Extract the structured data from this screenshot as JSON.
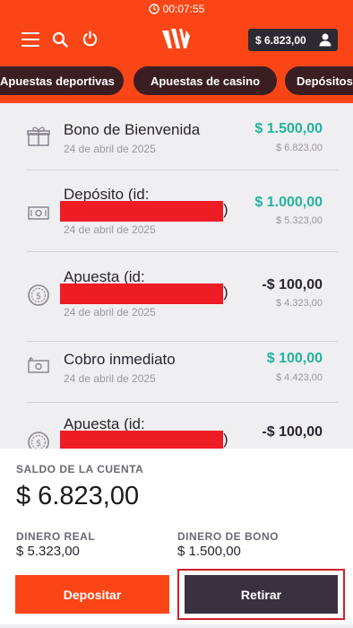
{
  "status_bar": {
    "time": "00:07:55"
  },
  "header": {
    "balance": "$ 6.823,00",
    "icons": [
      "menu-icon",
      "search-icon",
      "power-icon",
      "logo",
      "user-icon"
    ]
  },
  "tabs": [
    {
      "label": "Apuestas deportivas"
    },
    {
      "label": "Apuestas de casino"
    },
    {
      "label": "Depósitos"
    }
  ],
  "transactions": [
    {
      "icon": "gift-icon",
      "title": "Bono de Bienvenida",
      "date": "24 de abril de 2025",
      "amount": "$ 1.500,00",
      "balance": "$ 6.823,00",
      "positive": true
    },
    {
      "icon": "cash-in-icon",
      "title": "Depósito (id:",
      "title_end": ")",
      "date": "24 de abril de 2025",
      "amount": "$ 1.000,00",
      "balance": "$ 5.323,00",
      "positive": true,
      "redacted": true
    },
    {
      "icon": "coin-icon",
      "title": "Apuesta (id:",
      "title_end": ")",
      "date": "24 de abril de 2025",
      "amount": "-$ 100,00",
      "balance": "$ 4.323,00",
      "positive": false,
      "redacted": true
    },
    {
      "icon": "cash-out-icon",
      "title": "Cobro inmediato",
      "date": "24 de abril de 2025",
      "amount": "$ 100,00",
      "balance": "$ 4.423,00",
      "positive": true
    },
    {
      "icon": "coin-icon",
      "title": "Apuesta (id:",
      "title_end": ")",
      "amount": "-$ 100,00",
      "positive": false,
      "redacted": true
    }
  ],
  "account": {
    "balance_label": "SALDO DE LA CUENTA",
    "balance": "$ 6.823,00",
    "real_label": "DINERO REAL",
    "real_value": "$ 5.323,00",
    "bonus_label": "DINERO DE BONO",
    "bonus_value": "$ 1.500,00"
  },
  "actions": {
    "deposit": "Depositar",
    "withdraw": "Retirar"
  },
  "colors": {
    "brand": "#fa4616",
    "dark": "#3a3140",
    "positive": "#21b39d",
    "redaction": "#ee1c24"
  }
}
